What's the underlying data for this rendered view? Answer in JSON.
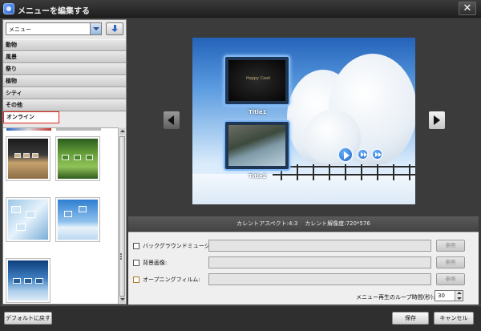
{
  "window": {
    "title": "メニューを編集する",
    "close_glyph": "✕",
    "app_icon": "app-icon"
  },
  "left_panel": {
    "combo_value": "メニュー",
    "download_icon": "download-icon",
    "categories": [
      {
        "label": "動物",
        "selected": false
      },
      {
        "label": "風景",
        "selected": false
      },
      {
        "label": "祭り",
        "selected": false
      },
      {
        "label": "植物",
        "selected": false
      },
      {
        "label": "シティ",
        "selected": false
      },
      {
        "label": "その他",
        "selected": false
      },
      {
        "label": "オンライン",
        "selected": true
      }
    ],
    "highlight_color": "#e3241b"
  },
  "preview": {
    "chapters": [
      {
        "label": "Title1",
        "caption": "Happy Cook"
      },
      {
        "label": "Title2"
      }
    ]
  },
  "info_bar": {
    "aspect": "カレントアスペクト:4:3",
    "resolution": "カレント解像度:720*576"
  },
  "options": {
    "rows": [
      {
        "label": "バックグラウンドミュージック:",
        "button": "参照"
      },
      {
        "label": "背景画像:",
        "button": "参照"
      },
      {
        "label": "オープニングフィルム:",
        "button": "参照"
      }
    ],
    "loop_label": "メニュー再生のループ時間(秒):",
    "loop_value": "30"
  },
  "footer": {
    "reset_label": "デフォルトに戻す",
    "save_label": "保存",
    "cancel_label": "キャンセル"
  }
}
